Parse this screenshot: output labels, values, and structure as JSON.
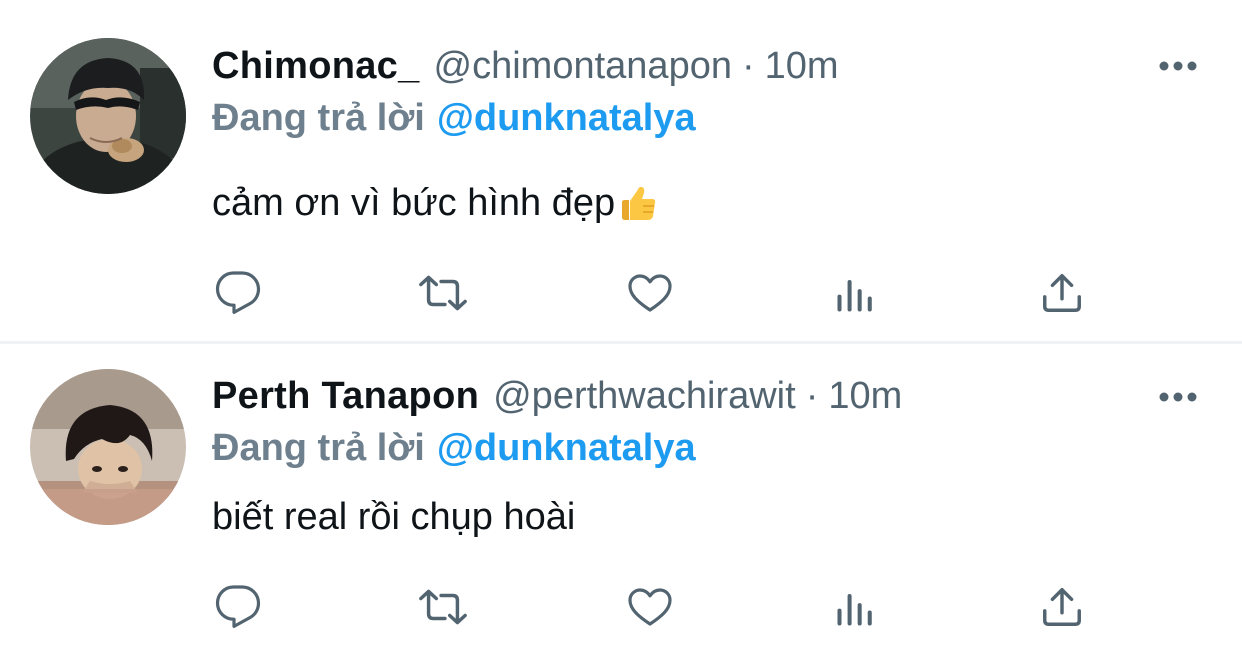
{
  "tweets": [
    {
      "display_name": "Chimonac_",
      "handle": "@chimontanapon",
      "separator": "·",
      "time": "10m",
      "reply_prefix": "Đang trả lời",
      "reply_to": "@dunknatalya",
      "text": "cảm ơn vì bức hình đẹp",
      "emoji": "thumbs-up-icon",
      "avatar": "avatar-photo-cap"
    },
    {
      "display_name": "Perth Tanapon",
      "handle": "@perthwachirawit",
      "separator": "·",
      "time": "10m",
      "reply_prefix": "Đang trả lời",
      "reply_to": "@dunknatalya",
      "text": "biết real rồi chụp hoài",
      "avatar": "avatar-photo-bath"
    }
  ],
  "icons": {
    "more": "more-icon",
    "reply": "reply-icon",
    "retweet": "retweet-icon",
    "like": "heart-icon",
    "views": "analytics-icon",
    "share": "share-icon"
  },
  "colors": {
    "text_primary": "#0f1419",
    "text_secondary": "#536471",
    "reply_prefix": "#6e7f8d",
    "mention": "#1d9bf0",
    "divider": "#eff3f4"
  }
}
